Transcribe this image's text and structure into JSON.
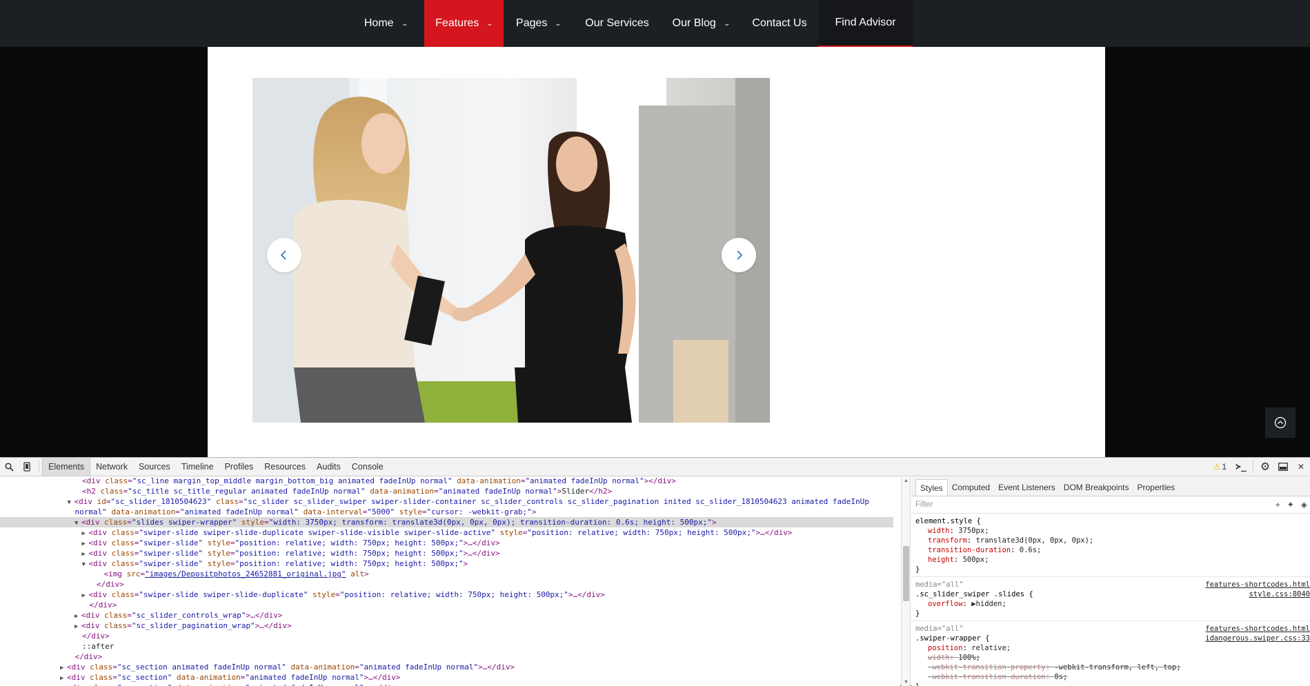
{
  "nav": {
    "items": [
      {
        "label": "Home",
        "chevron": true,
        "state": "normal"
      },
      {
        "label": "Features",
        "chevron": true,
        "state": "active"
      },
      {
        "label": "Pages",
        "chevron": true,
        "state": "normal"
      },
      {
        "label": "Our Services",
        "chevron": false,
        "state": "normal"
      },
      {
        "label": "Our Blog",
        "chevron": true,
        "state": "normal"
      },
      {
        "label": "Contact Us",
        "chevron": false,
        "state": "normal"
      },
      {
        "label": "Find Advisor",
        "chevron": false,
        "state": "finder"
      }
    ],
    "colors": {
      "bar": "#1d2023",
      "active": "#d5161e"
    }
  },
  "slider": {
    "image_description_icon": "handshake-photo",
    "prev_icon": "chevron-left-icon",
    "next_icon": "chevron-right-icon"
  },
  "devtools": {
    "tabs": [
      "Elements",
      "Network",
      "Sources",
      "Timeline",
      "Profiles",
      "Resources",
      "Audits",
      "Console"
    ],
    "active_tab": "Elements",
    "warning_count": "1",
    "dom_lines": [
      {
        "indent": 10,
        "tri": "",
        "parts": [
          [
            "tag",
            "<div "
          ],
          [
            "an",
            "class"
          ],
          [
            "tag",
            "="
          ],
          [
            "av",
            "\"sc_line margin_top_middle margin_bottom_big animated fadeInUp normal\""
          ],
          [
            "tag",
            " "
          ],
          [
            "an",
            "data-animation"
          ],
          [
            "tag",
            "="
          ],
          [
            "av",
            "\"animated fadeInUp normal\""
          ],
          [
            "tag",
            "></div>"
          ]
        ]
      },
      {
        "indent": 10,
        "tri": "",
        "parts": [
          [
            "tag",
            "<h2 "
          ],
          [
            "an",
            "class"
          ],
          [
            "tag",
            "="
          ],
          [
            "av",
            "\"sc_title sc_title_regular animated fadeInUp normal\""
          ],
          [
            "tag",
            " "
          ],
          [
            "an",
            "data-animation"
          ],
          [
            "tag",
            "="
          ],
          [
            "av",
            "\"animated fadeInUp normal\""
          ],
          [
            "tag",
            ">"
          ],
          [
            "tx",
            "Slider"
          ],
          [
            "tag",
            "</h2>"
          ]
        ]
      },
      {
        "indent": 9,
        "tri": "▼",
        "parts": [
          [
            "tag",
            "<div "
          ],
          [
            "an",
            "id"
          ],
          [
            "tag",
            "="
          ],
          [
            "av",
            "\"sc_slider_1810504623\""
          ],
          [
            "tag",
            " "
          ],
          [
            "an",
            "class"
          ],
          [
            "tag",
            "="
          ],
          [
            "av",
            "\"sc_slider sc_slider_swiper swiper-slider-container sc_slider_controls sc_slider_pagination inited sc_slider_1810504623 animated fadeInUp"
          ]
        ]
      },
      {
        "indent": 9,
        "tri": "",
        "parts": [
          [
            "av",
            "normal\""
          ],
          [
            "tag",
            " "
          ],
          [
            "an",
            "data-animation"
          ],
          [
            "tag",
            "="
          ],
          [
            "av",
            "\"animated fadeInUp normal\""
          ],
          [
            "tag",
            " "
          ],
          [
            "an",
            "data-interval"
          ],
          [
            "tag",
            "="
          ],
          [
            "av",
            "\"5000\""
          ],
          [
            "tag",
            " "
          ],
          [
            "an",
            "style"
          ],
          [
            "tag",
            "="
          ],
          [
            "av",
            "\"cursor: -webkit-grab;\""
          ],
          [
            "tag",
            ">"
          ]
        ]
      },
      {
        "indent": 10,
        "tri": "▼",
        "sel": true,
        "parts": [
          [
            "tag",
            "<div "
          ],
          [
            "an",
            "class"
          ],
          [
            "tag",
            "="
          ],
          [
            "av",
            "\"slides swiper-wrapper\""
          ],
          [
            "tag",
            " "
          ],
          [
            "an",
            "style"
          ],
          [
            "tag",
            "="
          ],
          [
            "av",
            "\"width: 3750px; transform: translate3d(0px, 0px, 0px); transition-duration: 0.6s; height: 500px;\""
          ],
          [
            "tag",
            ">"
          ]
        ]
      },
      {
        "indent": 11,
        "tri": "▶",
        "parts": [
          [
            "tag",
            "<div "
          ],
          [
            "an",
            "class"
          ],
          [
            "tag",
            "="
          ],
          [
            "av",
            "\"swiper-slide swiper-slide-duplicate swiper-slide-visible swiper-slide-active\""
          ],
          [
            "tag",
            " "
          ],
          [
            "an",
            "style"
          ],
          [
            "tag",
            "="
          ],
          [
            "av",
            "\"position: relative; width: 750px; height: 500px;\""
          ],
          [
            "tag",
            ">…</div>"
          ]
        ]
      },
      {
        "indent": 11,
        "tri": "▶",
        "parts": [
          [
            "tag",
            "<div "
          ],
          [
            "an",
            "class"
          ],
          [
            "tag",
            "="
          ],
          [
            "av",
            "\"swiper-slide\""
          ],
          [
            "tag",
            " "
          ],
          [
            "an",
            "style"
          ],
          [
            "tag",
            "="
          ],
          [
            "av",
            "\"position: relative; width: 750px; height: 500px;\""
          ],
          [
            "tag",
            ">…</div>"
          ]
        ]
      },
      {
        "indent": 11,
        "tri": "▶",
        "parts": [
          [
            "tag",
            "<div "
          ],
          [
            "an",
            "class"
          ],
          [
            "tag",
            "="
          ],
          [
            "av",
            "\"swiper-slide\""
          ],
          [
            "tag",
            " "
          ],
          [
            "an",
            "style"
          ],
          [
            "tag",
            "="
          ],
          [
            "av",
            "\"position: relative; width: 750px; height: 500px;\""
          ],
          [
            "tag",
            ">…</div>"
          ]
        ]
      },
      {
        "indent": 11,
        "tri": "▼",
        "parts": [
          [
            "tag",
            "<div "
          ],
          [
            "an",
            "class"
          ],
          [
            "tag",
            "="
          ],
          [
            "av",
            "\"swiper-slide\""
          ],
          [
            "tag",
            " "
          ],
          [
            "an",
            "style"
          ],
          [
            "tag",
            "="
          ],
          [
            "av",
            "\"position: relative; width: 750px; height: 500px;\""
          ],
          [
            "tag",
            ">"
          ]
        ]
      },
      {
        "indent": 13,
        "tri": "",
        "parts": [
          [
            "tag",
            "<img "
          ],
          [
            "an",
            "src"
          ],
          [
            "tag",
            "="
          ],
          [
            "lk",
            "\"images/Depositphotos_24652881_original.jpg\""
          ],
          [
            "tag",
            " "
          ],
          [
            "an",
            "alt"
          ],
          [
            "tag",
            ">"
          ]
        ]
      },
      {
        "indent": 12,
        "tri": "",
        "parts": [
          [
            "tag",
            "</div>"
          ]
        ]
      },
      {
        "indent": 11,
        "tri": "▶",
        "parts": [
          [
            "tag",
            "<div "
          ],
          [
            "an",
            "class"
          ],
          [
            "tag",
            "="
          ],
          [
            "av",
            "\"swiper-slide swiper-slide-duplicate\""
          ],
          [
            "tag",
            " "
          ],
          [
            "an",
            "style"
          ],
          [
            "tag",
            "="
          ],
          [
            "av",
            "\"position: relative; width: 750px; height: 500px;\""
          ],
          [
            "tag",
            ">…</div>"
          ]
        ]
      },
      {
        "indent": 11,
        "tri": "",
        "parts": [
          [
            "tag",
            "</div>"
          ]
        ]
      },
      {
        "indent": 10,
        "tri": "▶",
        "parts": [
          [
            "tag",
            "<div "
          ],
          [
            "an",
            "class"
          ],
          [
            "tag",
            "="
          ],
          [
            "av",
            "\"sc_slider_controls_wrap\""
          ],
          [
            "tag",
            ">…</div>"
          ]
        ]
      },
      {
        "indent": 10,
        "tri": "▶",
        "parts": [
          [
            "tag",
            "<div "
          ],
          [
            "an",
            "class"
          ],
          [
            "tag",
            "="
          ],
          [
            "av",
            "\"sc_slider_pagination_wrap\""
          ],
          [
            "tag",
            ">…</div>"
          ]
        ]
      },
      {
        "indent": 10,
        "tri": "",
        "parts": [
          [
            "tag",
            "</div>"
          ]
        ]
      },
      {
        "indent": 10,
        "tri": "",
        "parts": [
          [
            "tx",
            "::after"
          ]
        ]
      },
      {
        "indent": 9,
        "tri": "",
        "parts": [
          [
            "tag",
            "</div>"
          ]
        ]
      },
      {
        "indent": 8,
        "tri": "▶",
        "parts": [
          [
            "tag",
            "<div "
          ],
          [
            "an",
            "class"
          ],
          [
            "tag",
            "="
          ],
          [
            "av",
            "\"sc_section animated fadeInUp normal\""
          ],
          [
            "tag",
            " "
          ],
          [
            "an",
            "data-animation"
          ],
          [
            "tag",
            "="
          ],
          [
            "av",
            "\"animated fadeInUp normal\""
          ],
          [
            "tag",
            ">…</div>"
          ]
        ]
      },
      {
        "indent": 8,
        "tri": "▶",
        "parts": [
          [
            "tag",
            "<div "
          ],
          [
            "an",
            "class"
          ],
          [
            "tag",
            "="
          ],
          [
            "av",
            "\"sc_section\""
          ],
          [
            "tag",
            " "
          ],
          [
            "an",
            "data-animation"
          ],
          [
            "tag",
            "="
          ],
          [
            "av",
            "\"animated fadeInUp normal\""
          ],
          [
            "tag",
            ">…</div>"
          ]
        ]
      },
      {
        "indent": 8,
        "tri": "▶",
        "parts": [
          [
            "tag",
            "<div "
          ],
          [
            "an",
            "class"
          ],
          [
            "tag",
            "="
          ],
          [
            "av",
            "\"sc_section\""
          ],
          [
            "tag",
            " "
          ],
          [
            "an",
            "data-animation"
          ],
          [
            "tag",
            "="
          ],
          [
            "av",
            "\"animated fadeInUp normal\""
          ],
          [
            "tag",
            ">…</div>"
          ]
        ]
      }
    ],
    "styles_tabs": [
      "Styles",
      "Computed",
      "Event Listeners",
      "DOM Breakpoints",
      "Properties"
    ],
    "filter_placeholder": "Filter",
    "rules": [
      {
        "media": "",
        "selector": "element.style {",
        "source": [],
        "props": [
          {
            "name": "width",
            "value": "3750px;",
            "struck": false
          },
          {
            "name": "transform",
            "value": "translate3d(0px, 0px, 0px);",
            "struck": false
          },
          {
            "name": "transition-duration",
            "value": "0.6s;",
            "struck": false
          },
          {
            "name": "height",
            "value": "500px;",
            "struck": false
          }
        ]
      },
      {
        "media": "media=\"all\"",
        "selector": ".sc_slider_swiper .slides {",
        "source": [
          "features-shortcodes.html",
          "style.css:8040"
        ],
        "props": [
          {
            "name": "overflow",
            "value": "▶hidden;",
            "struck": false
          }
        ]
      },
      {
        "media": "media=\"all\"",
        "selector": ".swiper-wrapper {",
        "source": [
          "features-shortcodes.html",
          "idangerous.swiper.css:33"
        ],
        "props": [
          {
            "name": "position",
            "value": "relative;",
            "struck": false
          },
          {
            "name": "width",
            "value": "100%;",
            "struck": true
          },
          {
            "name": "-webkit-transition-property",
            "value": "-webkit-transform, left, top;",
            "struck": true
          },
          {
            "name": "-webkit-transition-duration",
            "value": "0s;",
            "struck": true
          }
        ]
      }
    ]
  }
}
